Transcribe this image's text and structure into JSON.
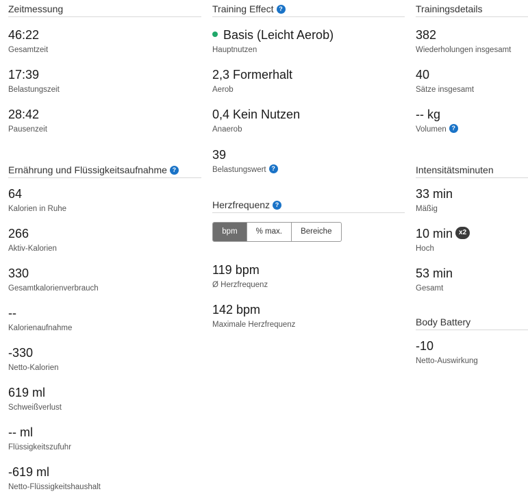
{
  "zeitmessung": {
    "title": "Zeitmessung",
    "stats": [
      {
        "value": "46:22",
        "label": "Gesamtzeit"
      },
      {
        "value": "17:39",
        "label": "Belastungszeit"
      },
      {
        "value": "28:42",
        "label": "Pausenzeit"
      }
    ]
  },
  "ernaehrung": {
    "title": "Ernährung und Flüssigkeitsaufnahme",
    "stats": [
      {
        "value": "64",
        "label": "Kalorien in Ruhe"
      },
      {
        "value": "266",
        "label": "Aktiv-Kalorien"
      },
      {
        "value": "330",
        "label": "Gesamtkalorienverbrauch"
      },
      {
        "value": "--",
        "label": "Kalorienaufnahme"
      },
      {
        "value": "-330",
        "label": "Netto-Kalorien"
      },
      {
        "value": "619 ml",
        "label": "Schweißverlust"
      },
      {
        "value": "-- ml",
        "label": "Flüssigkeitszufuhr"
      },
      {
        "value": "-619 ml",
        "label": "Netto-Flüssigkeitshaushalt"
      }
    ]
  },
  "training_effect": {
    "title": "Training Effect",
    "stats": [
      {
        "value": "Basis (Leicht Aerob)",
        "label": "Hauptnutzen"
      },
      {
        "value": "2,3 Formerhalt",
        "label": "Aerob"
      },
      {
        "value": "0,4 Kein Nutzen",
        "label": "Anaerob"
      },
      {
        "value": "39",
        "label": "Belastungswert"
      }
    ]
  },
  "herzfrequenz": {
    "title": "Herzfrequenz",
    "tabs": [
      "bpm",
      "% max.",
      "Bereiche"
    ],
    "active_tab": "bpm",
    "stats": [
      {
        "value": "119 bpm",
        "label": "Ø Herzfrequenz"
      },
      {
        "value": "142 bpm",
        "label": "Maximale Herzfrequenz"
      }
    ]
  },
  "trainingsdetails": {
    "title": "Trainingsdetails",
    "stats": [
      {
        "value": "382",
        "label": "Wiederholungen insgesamt"
      },
      {
        "value": "40",
        "label": "Sätze insgesamt"
      },
      {
        "value": "-- kg",
        "label": "Volumen"
      }
    ]
  },
  "intensitaet": {
    "title": "Intensitätsminuten",
    "stats": [
      {
        "value": "33 min",
        "label": "Mäßig"
      },
      {
        "value": "10 min",
        "label": "Hoch",
        "badge": "x2"
      },
      {
        "value": "53 min",
        "label": "Gesamt"
      }
    ]
  },
  "body_battery": {
    "title": "Body Battery",
    "stats": [
      {
        "value": "-10",
        "label": "Netto-Auswirkung"
      }
    ]
  },
  "help_icon_glyph": "?",
  "colors": {
    "help": "#1a73c7",
    "hauptnutzen_dot": "#20a86a",
    "active_tab": "#6e6e6e"
  }
}
